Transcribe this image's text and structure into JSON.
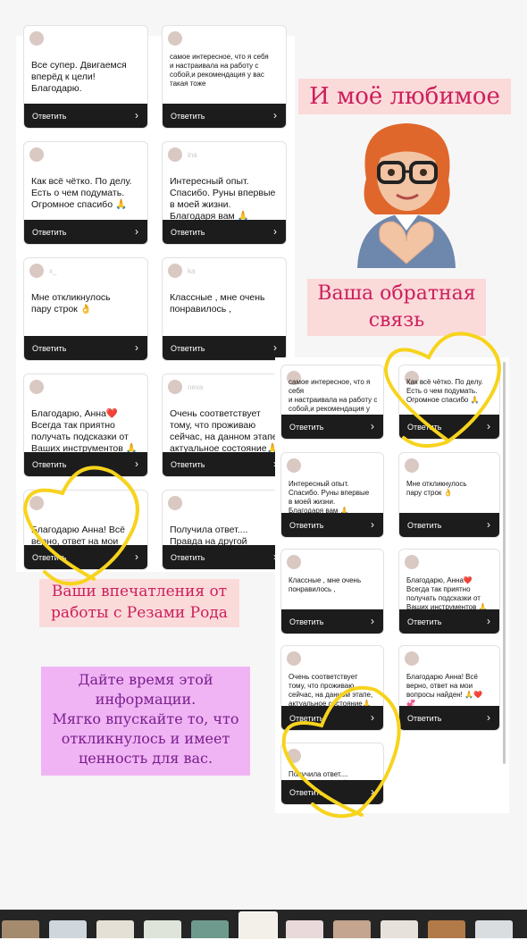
{
  "reply_label": "Ответить",
  "chevron": "›",
  "cards_left": [
    {
      "name": "",
      "text": "Все супер. Двигаемся\nвперёд к цели!\nБлагодарю.",
      "small": false
    },
    {
      "name": "",
      "text": "самое интересное, что я себя\nи настраивала на работу с\nсобой,и рекомендация у вас\nтакая тоже",
      "small": true
    },
    {
      "name": "",
      "text": "Как всё чётко. По делу.\nЕсть о чем подумать.\nОгромное спасибо 🙏",
      "small": false
    },
    {
      "name": "ina",
      "text": "Интересный опыт.\nСпасибо. Руны впервые\nв моей жизни.\nБлагодаря вам 🙏",
      "small": false
    },
    {
      "name": "x_",
      "text": "Мне откликнулось\nпару строк 👌",
      "small": false
    },
    {
      "name": "ka",
      "text": "Классные , мне очень\nпонравилось ,",
      "small": false
    },
    {
      "name": "",
      "text": "Благодарю, Анна❤️\nВсегда так приятно\nполучать подсказки от\nВаших инструментов 🙏",
      "small": false
    },
    {
      "name": "neva",
      "text": "Очень соответствует\nтому,  что проживаю\nсейчас, на данном этапе,\nактуальное состояние🙏",
      "small": false
    },
    {
      "name": "",
      "text": "Благодарю Анна! Всё\nверно, ответ на мои\nвопросы найден! 🙏❤️\n💞",
      "small": false
    },
    {
      "name": "",
      "text": "Получила ответ....\nПравда на другой\nвопрос.... Благодарю",
      "small": false
    }
  ],
  "cards_right": [
    {
      "name": "",
      "text": "самое интересное, что я себя\nи настраивала на работу с\nсобой,и рекомендация у вас\nтакая тоже",
      "small": true
    },
    {
      "name": "",
      "text": "Как всё чётко. По делу.\nЕсть о чем подумать.\nОгромное спасибо 🙏",
      "small": true
    },
    {
      "name": "",
      "text": "Интересный опыт.\nСпасибо. Руны впервые\nв моей жизни.\nБлагодаря вам 🙏",
      "small": true
    },
    {
      "name": "",
      "text": "Мне откликнулось\nпару строк 👌",
      "small": true
    },
    {
      "name": "",
      "text": "Классные , мне очень\nпонравилось ,",
      "small": true
    },
    {
      "name": "",
      "text": "Благодарю, Анна❤️\nВсегда так приятно\nполучать подсказки от\nВаших инструментов 🙏",
      "small": true
    },
    {
      "name": "",
      "text": "Очень соответствует\nтому,  что проживаю\nсейчас, на данном этапе,\nактуальное состояние🙏",
      "small": true
    },
    {
      "name": "",
      "text": "Благодарю Анна! Всё\nверно, ответ на мои\nвопросы найден! 🙏❤️\n💞",
      "small": true
    },
    {
      "name": "",
      "text": "Получила ответ....\nПравда на другой\nвопрос.... Благодарю",
      "small": true
    }
  ],
  "notes": {
    "favorite": "И моё любимое",
    "feedback": "Ваша обратная\nсвязь",
    "impressions": "Ваши впечатления от\nработы с Резами Рода",
    "advice": "Дайте время этой\nинформации.\nМягко впускайте то, что\nоткликнулось и имеет\nценность для вас."
  },
  "colors": {
    "note_pink_bg": "#fbdada",
    "note_pink_text": "#cc1f5c",
    "note_violet_bg": "#f0b4f5",
    "note_violet_text": "#7a1f8c",
    "heart_yellow": "#f7d31c",
    "reply_bar": "#1c1c1c"
  },
  "icons": {
    "avatar": "memoji-avatar-icon",
    "heart": "heart-doodle-icon"
  },
  "thumbnails": [
    {
      "color": "#a58b6e"
    },
    {
      "color": "#cfd6dc"
    },
    {
      "color": "#e4e0d6"
    },
    {
      "color": "#dfe4da"
    },
    {
      "color": "#6e9a8e"
    },
    {
      "color": "#f3efe9"
    },
    {
      "color": "#e9d9db"
    },
    {
      "color": "#c4a58f"
    },
    {
      "color": "#e6e1da"
    },
    {
      "color": "#b27a48"
    },
    {
      "color": "#d9dde0"
    }
  ]
}
